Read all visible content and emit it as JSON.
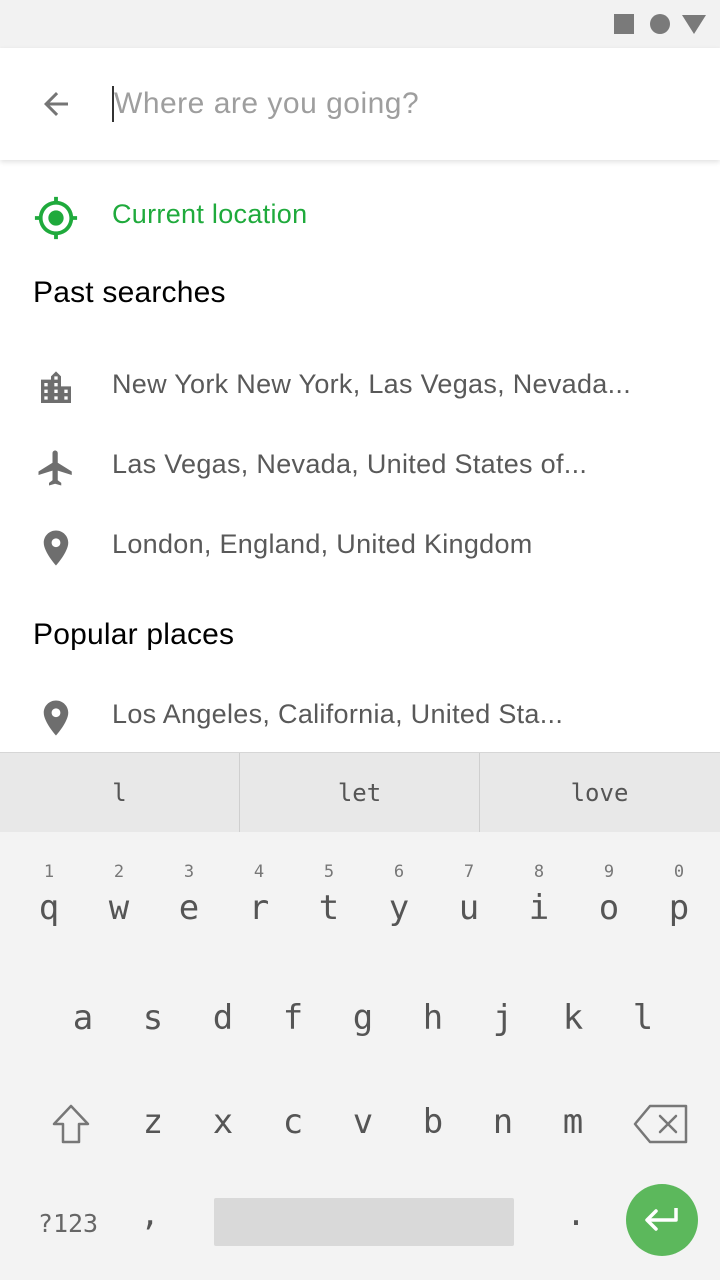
{
  "search": {
    "placeholder": "Where are you going?",
    "value": ""
  },
  "current_location": {
    "label": "Current location",
    "icon": "my-location-icon",
    "color": "#1faa3c"
  },
  "past_searches": {
    "title": "Past searches",
    "items": [
      {
        "icon": "city-icon",
        "label": "New York New York, Las Vegas, Nevada..."
      },
      {
        "icon": "airplane-icon",
        "label": "Las Vegas, Nevada, United States of..."
      },
      {
        "icon": "location-pin-icon",
        "label": "London, England, United Kingdom"
      }
    ]
  },
  "popular_places": {
    "title": "Popular places",
    "items": [
      {
        "icon": "location-pin-icon",
        "label": "Los Angeles, California, United Sta..."
      }
    ]
  },
  "keyboard": {
    "suggestions": [
      "l",
      "let",
      "love"
    ],
    "row1_hints": [
      "1",
      "2",
      "3",
      "4",
      "5",
      "6",
      "7",
      "8",
      "9",
      "0"
    ],
    "row1": [
      "q",
      "w",
      "e",
      "r",
      "t",
      "y",
      "u",
      "i",
      "o",
      "p"
    ],
    "row2": [
      "a",
      "s",
      "d",
      "f",
      "g",
      "h",
      "j",
      "k",
      "l"
    ],
    "row3": [
      "z",
      "x",
      "c",
      "v",
      "b",
      "n",
      "m"
    ],
    "symbols_label": "?123",
    "comma": ",",
    "period": ".",
    "enter_color": "#5cb85c"
  }
}
